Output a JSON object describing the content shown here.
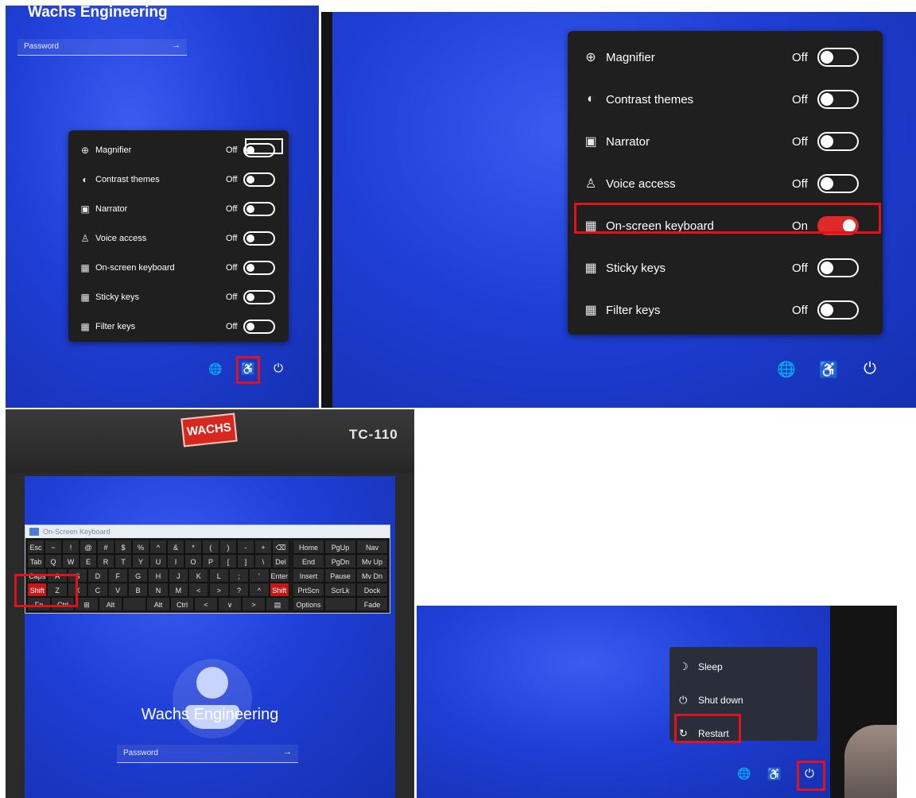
{
  "panel1": {
    "title": "Wachs Engineering",
    "password_placeholder": "Password",
    "arrow": "→",
    "items": [
      {
        "icon": "magnifier-icon",
        "glyph": "⊕",
        "label": "Magnifier",
        "state": "Off"
      },
      {
        "icon": "contrast-icon",
        "glyph": "◐",
        "label": "Contrast themes",
        "state": "Off"
      },
      {
        "icon": "narrator-icon",
        "glyph": "▣",
        "label": "Narrator",
        "state": "Off"
      },
      {
        "icon": "voice-access-icon",
        "glyph": "♙",
        "label": "Voice access",
        "state": "Off"
      },
      {
        "icon": "keyboard-icon",
        "glyph": "▦",
        "label": "On-screen keyboard",
        "state": "Off"
      },
      {
        "icon": "sticky-keys-icon",
        "glyph": "▦",
        "label": "Sticky keys",
        "state": "Off"
      },
      {
        "icon": "filter-keys-icon",
        "glyph": "▦",
        "label": "Filter keys",
        "state": "Off"
      }
    ],
    "tray": {
      "network": "🌐",
      "accessibility": "♿",
      "power": "⏻"
    }
  },
  "panel2": {
    "items": [
      {
        "icon": "magnifier-icon",
        "glyph": "⊕",
        "label": "Magnifier",
        "state": "Off",
        "on": false
      },
      {
        "icon": "contrast-icon",
        "glyph": "◐",
        "label": "Contrast themes",
        "state": "Off",
        "on": false
      },
      {
        "icon": "narrator-icon",
        "glyph": "▣",
        "label": "Narrator",
        "state": "Off",
        "on": false
      },
      {
        "icon": "voice-access-icon",
        "glyph": "♙",
        "label": "Voice access",
        "state": "Off",
        "on": false
      },
      {
        "icon": "keyboard-icon",
        "glyph": "▦",
        "label": "On-screen keyboard",
        "state": "On",
        "on": true
      },
      {
        "icon": "sticky-keys-icon",
        "glyph": "▦",
        "label": "Sticky keys",
        "state": "Off",
        "on": false
      },
      {
        "icon": "filter-keys-icon",
        "glyph": "▦",
        "label": "Filter keys",
        "state": "Off",
        "on": false
      }
    ],
    "tray": {
      "network": "🌐",
      "accessibility": "♿",
      "power": "⏻"
    }
  },
  "panel3": {
    "brand": "WACHS",
    "model": "TC-110",
    "osk_title": "On-Screen Keyboard",
    "user_name": "Wachs Engineering",
    "password_placeholder": "Password",
    "arrow": "→",
    "rows": [
      [
        "Esc",
        "~",
        "!",
        "@",
        "#",
        "$",
        "%",
        "^",
        "&",
        "*",
        "(",
        ")",
        "-",
        "+",
        "⌫"
      ],
      [
        "Tab",
        "Q",
        "W",
        "E",
        "R",
        "T",
        "Y",
        "U",
        "I",
        "O",
        "P",
        "[",
        "]",
        "\\",
        "Del"
      ],
      [
        "Caps",
        "A",
        "S",
        "D",
        "F",
        "G",
        "H",
        "J",
        "K",
        "L",
        ";",
        "'",
        "Enter"
      ],
      [
        "Shift",
        "Z",
        "X",
        "C",
        "V",
        "B",
        "N",
        "M",
        "<",
        ">",
        "?",
        "^",
        "Shift"
      ],
      [
        "Fn",
        "Ctrl",
        "⊞",
        "Alt",
        "",
        "Alt",
        "Ctrl",
        "<",
        "∨",
        ">",
        "▤"
      ]
    ],
    "nav_keys": [
      [
        "Home",
        "PgUp",
        "Nav"
      ],
      [
        "End",
        "PgDn",
        "Mv Up"
      ],
      [
        "Insert",
        "Pause",
        "Mv Dn"
      ],
      [
        "PrtScn",
        "ScrLk",
        "Dock"
      ],
      [
        "Options",
        "",
        "Fade"
      ]
    ]
  },
  "panel4": {
    "menu": [
      {
        "icon": "sleep-icon",
        "glyph": "☽",
        "label": "Sleep"
      },
      {
        "icon": "shutdown-icon",
        "glyph": "⏻",
        "label": "Shut down"
      },
      {
        "icon": "restart-icon",
        "glyph": "↻",
        "label": "Restart"
      }
    ],
    "tray": {
      "network": "🌐",
      "accessibility": "♿",
      "power": "⏻"
    }
  },
  "colors": {
    "highlight": "#e0131b",
    "toggle_on": "#e02a2a",
    "desktop_blue": "#1f3fd6"
  }
}
